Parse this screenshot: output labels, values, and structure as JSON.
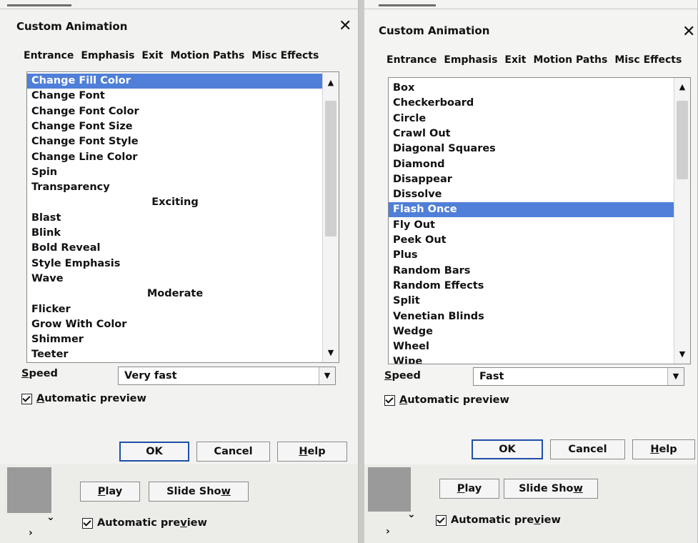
{
  "left": {
    "title": "Custom Animation",
    "close_glyph": "✕",
    "tabs": [
      "Entrance",
      "Emphasis",
      "Exit",
      "Motion Paths",
      "Misc Effects"
    ],
    "items": [
      {
        "text": "Change Fill Color",
        "selected": true
      },
      {
        "text": "Change Font"
      },
      {
        "text": "Change Font Color"
      },
      {
        "text": "Change Font Size"
      },
      {
        "text": "Change Font Style"
      },
      {
        "text": "Change Line Color"
      },
      {
        "text": "Spin"
      },
      {
        "text": "Transparency"
      },
      {
        "text": "Exciting",
        "group": true
      },
      {
        "text": "Blast"
      },
      {
        "text": "Blink"
      },
      {
        "text": "Bold Reveal"
      },
      {
        "text": "Style Emphasis"
      },
      {
        "text": "Wave"
      },
      {
        "text": "Moderate",
        "group": true
      },
      {
        "text": "Flicker"
      },
      {
        "text": "Grow With Color"
      },
      {
        "text": "Shimmer"
      },
      {
        "text": "Teeter"
      }
    ],
    "speed_label": "Speed",
    "speed_value": "Very fast",
    "auto_preview": "Automatic preview",
    "ok": "OK",
    "cancel": "Cancel",
    "help": "Help",
    "play": "Play",
    "slideshow": "Slide Show",
    "auto_preview2": "Automatic preview"
  },
  "right": {
    "title": "Custom Animation",
    "close_glyph": "✕",
    "tabs": [
      "Entrance",
      "Emphasis",
      "Exit",
      "Motion Paths",
      "Misc Effects"
    ],
    "items": [
      {
        "text": "Box"
      },
      {
        "text": "Checkerboard"
      },
      {
        "text": "Circle"
      },
      {
        "text": "Crawl Out"
      },
      {
        "text": "Diagonal Squares"
      },
      {
        "text": "Diamond"
      },
      {
        "text": "Disappear"
      },
      {
        "text": "Dissolve"
      },
      {
        "text": "Flash Once",
        "selected": true
      },
      {
        "text": "Fly Out"
      },
      {
        "text": "Peek Out"
      },
      {
        "text": "Plus"
      },
      {
        "text": "Random Bars"
      },
      {
        "text": "Random Effects"
      },
      {
        "text": "Split"
      },
      {
        "text": "Venetian Blinds"
      },
      {
        "text": "Wedge"
      },
      {
        "text": "Wheel"
      },
      {
        "text": "Wipe"
      }
    ],
    "speed_label": "Speed",
    "speed_value": "Fast",
    "auto_preview": "Automatic preview",
    "ok": "OK",
    "cancel": "Cancel",
    "help": "Help",
    "play": "Play",
    "slideshow": "Slide Show",
    "auto_preview2": "Automatic preview"
  },
  "icons": {
    "scroll_up": "▲",
    "scroll_down": "▼",
    "dropdown": "▼",
    "chevron_down": "⌄",
    "chevron_right": "›"
  },
  "colors": {
    "selection": "#4f7fd8",
    "default_button_border": "#1f4fa8"
  }
}
